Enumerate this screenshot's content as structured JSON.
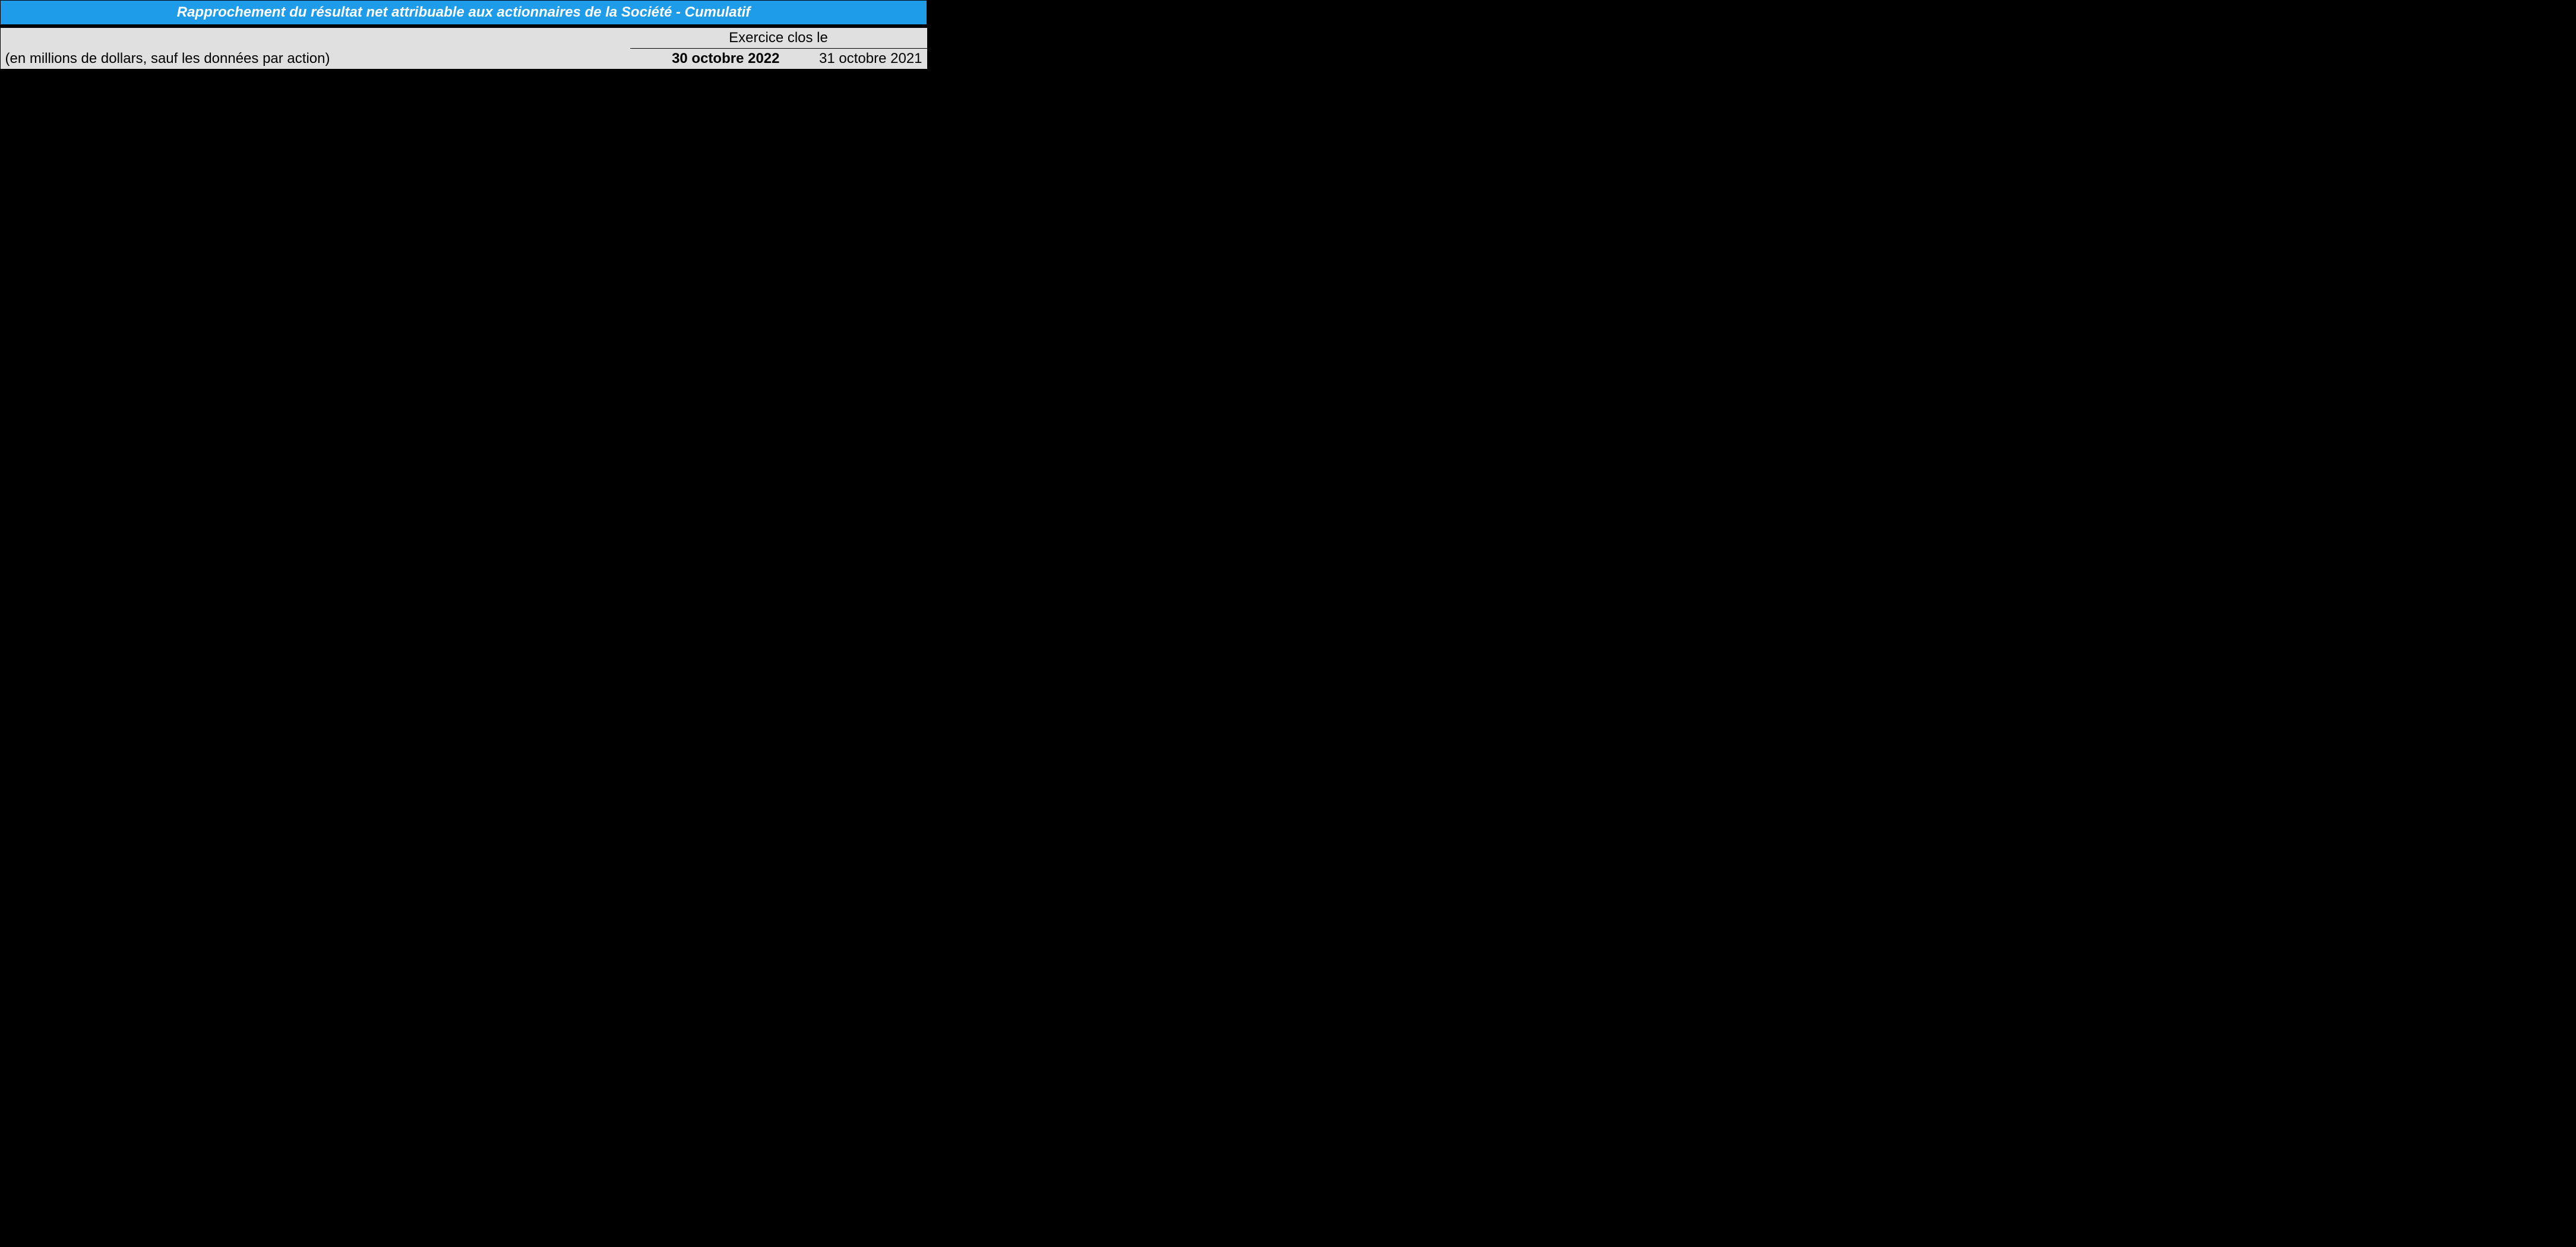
{
  "title": "Rapprochement du résultat net attribuable aux actionnaires de la Société - Cumulatif",
  "period_label": "Exercice clos le",
  "units_label": "(en millions de dollars, sauf les données par action)",
  "columns": {
    "col_2022": "30 octobre 2022",
    "col_2021": "31 octobre 2021"
  }
}
